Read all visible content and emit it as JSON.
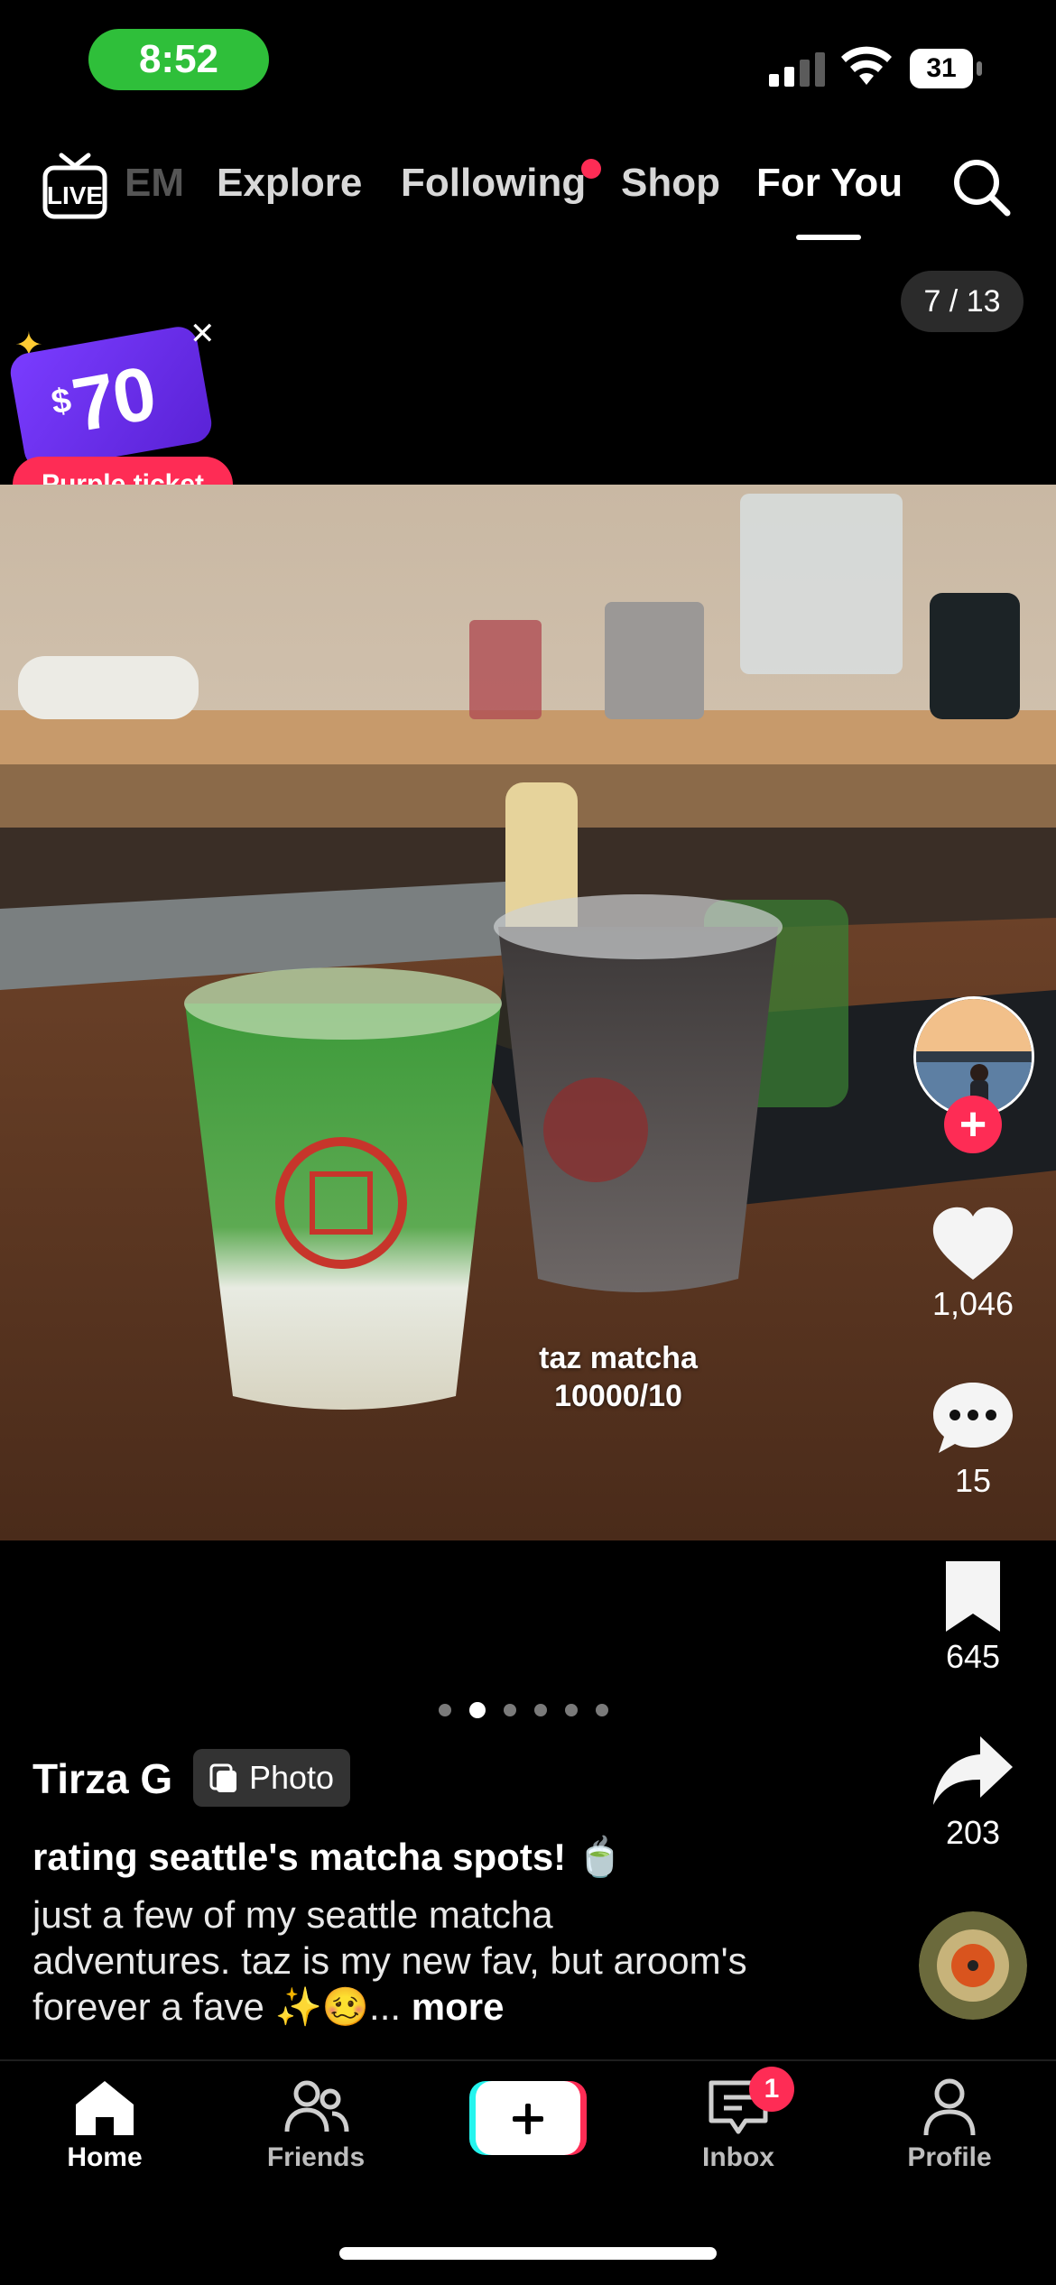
{
  "status_bar": {
    "time": "8:52",
    "battery": "31"
  },
  "top_nav": {
    "tabs": [
      {
        "label": "EM",
        "partial": true
      },
      {
        "label": "Explore"
      },
      {
        "label": "Following",
        "has_dot": true
      },
      {
        "label": "Shop"
      },
      {
        "label": "For You",
        "active": true
      }
    ],
    "live_icon": "live-icon",
    "search_icon": "search-icon"
  },
  "carousel": {
    "counter": "7 / 13",
    "dots_total": 6,
    "active_dot": 2
  },
  "promo": {
    "amount": "70",
    "currency": "$",
    "label": "Purple ticket"
  },
  "photo": {
    "overlay_line1": "taz matcha",
    "overlay_line2": "10000/10"
  },
  "actions": {
    "likes": "1,046",
    "comments": "15",
    "saves": "645",
    "shares": "203"
  },
  "post": {
    "author": "Tirza G",
    "badge": "Photo",
    "title": "rating seattle's matcha spots! 🍵",
    "description": "just a few of my seattle matcha adventures. taz is my new fav, but aroom's forever a fave ✨🥴...",
    "more": "more"
  },
  "bottom_nav": {
    "home": "Home",
    "friends": "Friends",
    "inbox": "Inbox",
    "inbox_badge": "1",
    "profile": "Profile"
  },
  "colors": {
    "accent": "#fe2c55",
    "time_pill": "#2fbf3a",
    "teal": "#25f4ee"
  }
}
